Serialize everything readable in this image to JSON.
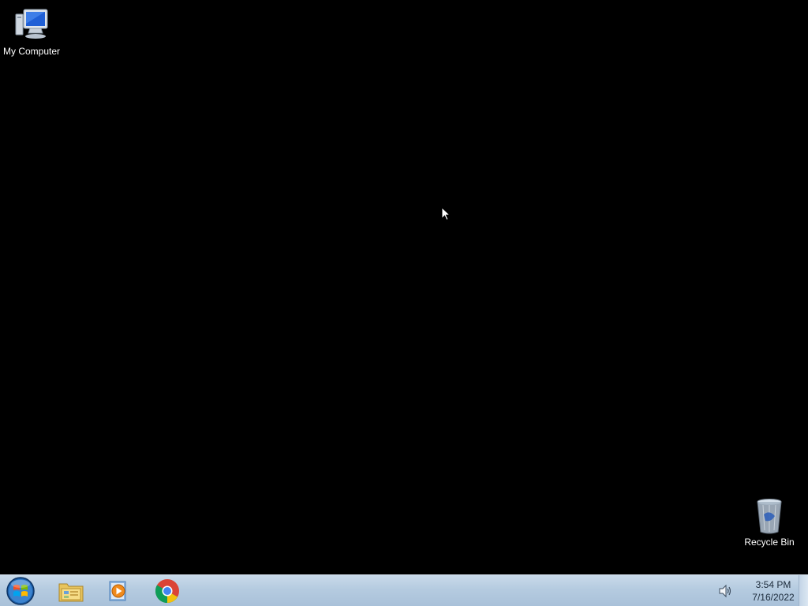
{
  "desktop": {
    "icons": [
      {
        "label": "My Computer",
        "icon": "computer-icon"
      },
      {
        "label": "Recycle Bin",
        "icon": "recycle-bin-icon"
      }
    ]
  },
  "taskbar": {
    "start": {
      "icon": "windows-start-orb-icon"
    },
    "pinned": [
      {
        "icon": "windows-explorer-icon"
      },
      {
        "icon": "windows-media-player-icon"
      },
      {
        "icon": "google-chrome-icon"
      }
    ],
    "tray": {
      "volume_icon": "speaker-icon",
      "time": "3:54 PM",
      "date": "7/16/2022"
    }
  },
  "colors": {
    "desktop_background": "#000000",
    "taskbar": "#b5cbe0"
  }
}
